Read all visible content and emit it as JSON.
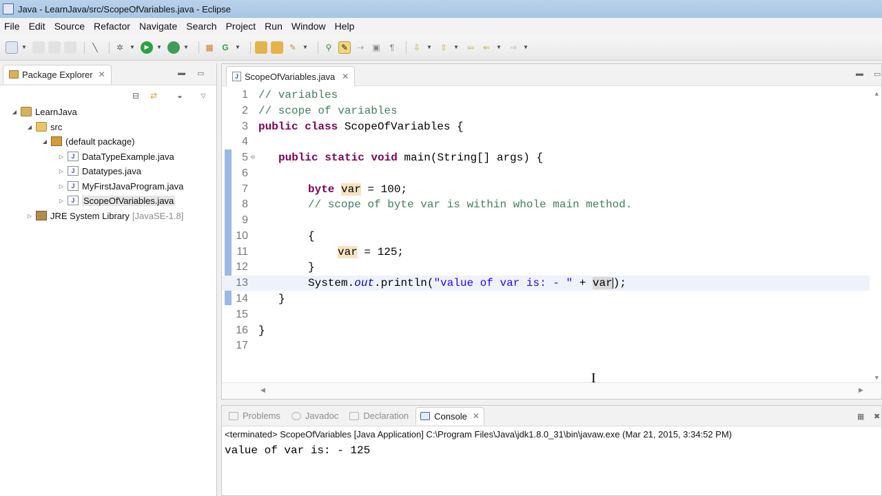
{
  "window": {
    "title": "Java - LearnJava/src/ScopeOfVariables.java - Eclipse"
  },
  "menu": [
    "File",
    "Edit",
    "Source",
    "Refactor",
    "Navigate",
    "Search",
    "Project",
    "Run",
    "Window",
    "Help"
  ],
  "package_explorer": {
    "tab_label": "Package Explorer",
    "tree": {
      "project": "LearnJava",
      "src": "src",
      "package": "(default package)",
      "files": [
        "DataTypeExample.java",
        "Datatypes.java",
        "MyFirstJavaProgram.java",
        "ScopeOfVariables.java"
      ],
      "library": "JRE System Library",
      "library_suffix": "[JavaSE-1.8]"
    }
  },
  "editor": {
    "tab_label": "ScopeOfVariables.java",
    "line_numbers": [
      "1",
      "2",
      "3",
      "4",
      "5",
      "6",
      "7",
      "8",
      "9",
      "10",
      "11",
      "12",
      "13",
      "14",
      "15",
      "16",
      "17"
    ]
  },
  "code_text": {
    "l1": "// variables",
    "l2": "// scope of variables",
    "l3_kw": "public class",
    "l3_rest": " ScopeOfVariables {",
    "l5_kw": "public static void",
    "l5_rest": " main(String[] args) {",
    "l7_kw": "byte",
    "l7_var": "var",
    "l7_rest": " = 100;",
    "l8": "// scope of byte var is within whole main method.",
    "l10": "{",
    "l11_var": "var",
    "l11_rest": " = 125;",
    "l12": "}",
    "l13_a": "System.",
    "l13_field": "out",
    "l13_b": ".println(",
    "l13_str": "\"value of var is: - \"",
    "l13_c": " + ",
    "l13_var": "var",
    "l13_d": ");",
    "l14": "}",
    "l16": "}"
  },
  "bottom": {
    "tabs": [
      "Problems",
      "Javadoc",
      "Declaration",
      "Console"
    ],
    "active_tab": "Console",
    "status": "<terminated> ScopeOfVariables [Java Application] C:\\Program Files\\Java\\jdk1.8.0_31\\bin\\javaw.exe (Mar 21, 2015, 3:34:52 PM)",
    "output": "value of var is: - 125"
  }
}
